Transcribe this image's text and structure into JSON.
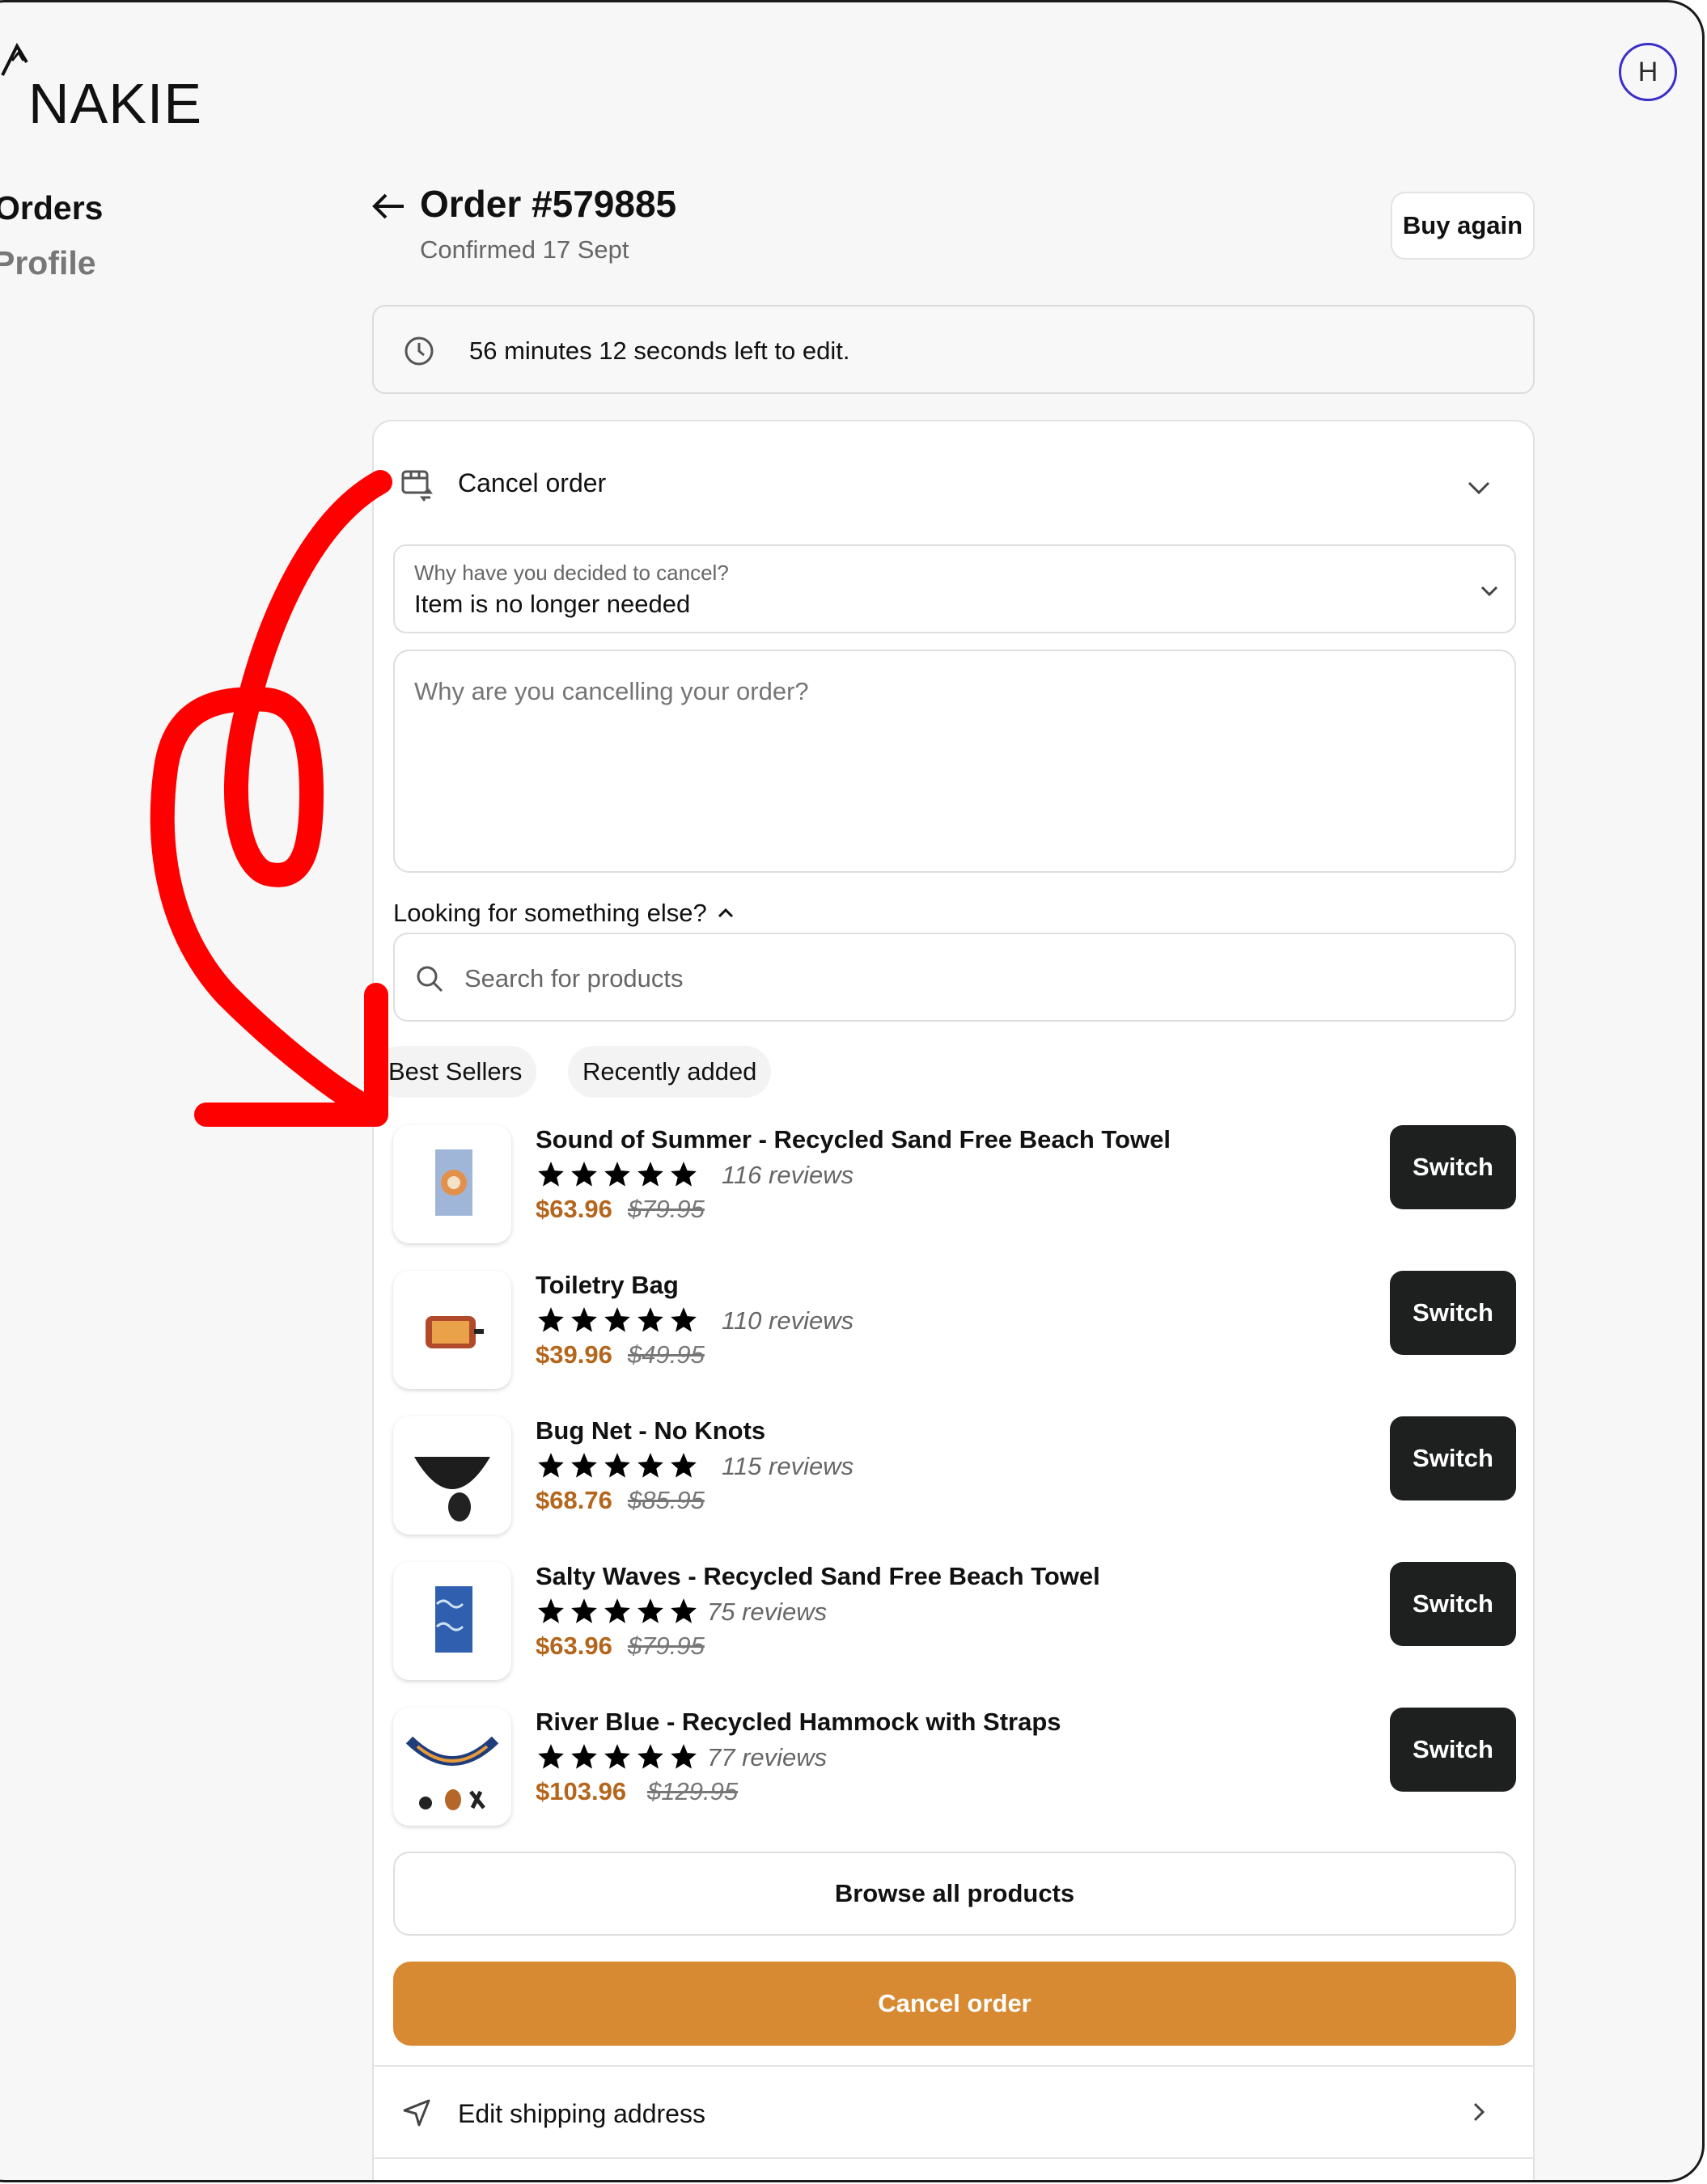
{
  "brand": {
    "logo_text": "NAKIE",
    "accent": "#d88a32",
    "price_color": "#b3661c"
  },
  "user": {
    "avatar_initial": "H"
  },
  "nav": {
    "items": [
      {
        "label": "Orders",
        "active": true
      },
      {
        "label": "Profile",
        "active": false
      }
    ]
  },
  "order": {
    "title": "Order #579885",
    "subtitle": "Confirmed 17 Sept",
    "buy_again_label": "Buy again",
    "edit_timer_text": "56 minutes 12 seconds left to edit."
  },
  "cancel_panel": {
    "title": "Cancel order",
    "reason_label": "Why have you decided to cancel?",
    "reason_value": "Item is no longer needed",
    "comment_placeholder": "Why are you cancelling your order?",
    "looking_label": "Looking for something else?",
    "search_placeholder": "Search for products",
    "chips": [
      "Best Sellers",
      "Recently added"
    ],
    "browse_label": "Browse all products",
    "cancel_button_label": "Cancel order"
  },
  "products": [
    {
      "name": "Sound of Summer - Recycled Sand Free Beach Towel",
      "rating": 5,
      "reviews": "116 reviews",
      "price": "$63.96",
      "old_price": "$79.95",
      "switch_label": "Switch",
      "thumb_icon": "beach-towel-mandala"
    },
    {
      "name": "Toiletry Bag",
      "rating": 5,
      "reviews": "110 reviews",
      "price": "$39.96",
      "old_price": "$49.95",
      "switch_label": "Switch",
      "thumb_icon": "toiletry-bag"
    },
    {
      "name": "Bug Net - No Knots",
      "rating": 5,
      "reviews": "115 reviews",
      "price": "$68.76",
      "old_price": "$85.95",
      "switch_label": "Switch",
      "thumb_icon": "bug-net"
    },
    {
      "name": "Salty Waves - Recycled Sand Free Beach Towel",
      "rating": 5,
      "reviews": "75 reviews",
      "price": "$63.96",
      "old_price": "$79.95",
      "switch_label": "Switch",
      "thumb_icon": "beach-towel-waves"
    },
    {
      "name": "River Blue - Recycled Hammock with Straps",
      "rating": 5,
      "reviews": "77 reviews",
      "price": "$103.96",
      "old_price": "$129.95",
      "switch_label": "Switch",
      "thumb_icon": "hammock"
    }
  ],
  "shipping": {
    "label": "Edit shipping address"
  }
}
